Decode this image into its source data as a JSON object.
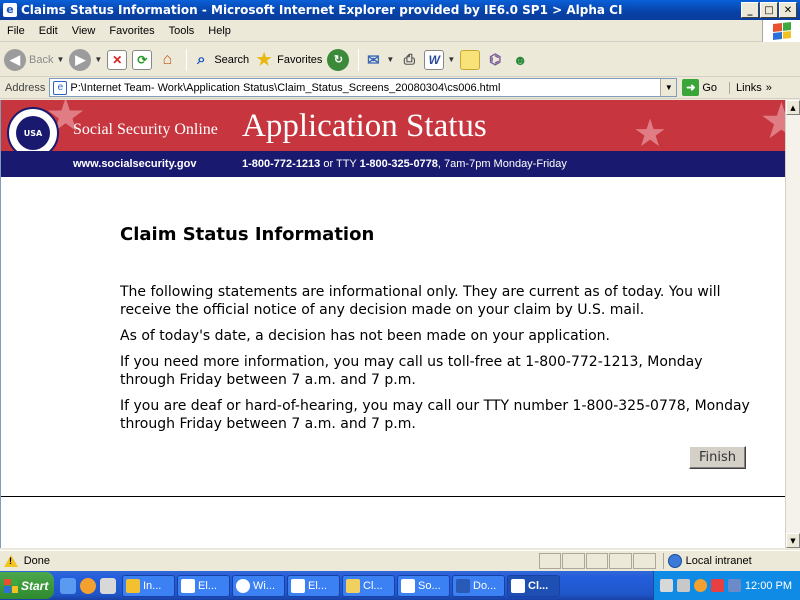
{
  "window": {
    "title": "Claims Status Information - Microsoft Internet Explorer provided by IE6.0 SP1 > Alpha CI",
    "buttons": {
      "minimize": "_",
      "maximize": "□",
      "close": "✕"
    }
  },
  "menu": [
    "File",
    "Edit",
    "View",
    "Favorites",
    "Tools",
    "Help"
  ],
  "toolbar": {
    "back": "Back",
    "search": "Search",
    "favorites": "Favorites"
  },
  "address": {
    "label": "Address",
    "url": "P:\\Internet Team- Work\\Application Status\\Claim_Status_Screens_20080304\\cs006.html",
    "go": "Go",
    "links": "Links"
  },
  "banner": {
    "seal_text": "USA",
    "brand": "Social Security Online",
    "title": "Application Status",
    "website": "www.socialsecurity.gov",
    "phone": "1-800-772-1213",
    "tty_prefix": " or TTY ",
    "tty": "1-800-325-0778",
    "hours": ", 7am-7pm Monday-Friday"
  },
  "page": {
    "heading": "Claim Status Information",
    "paragraphs": [
      "The following statements are informational only. They are current as of today. You will receive the official notice of any decision made on your claim by U.S. mail.",
      "As of today's date, a decision has not been made on your application.",
      "If you need more information, you may call us toll-free at 1-800-772-1213, Monday through Friday between 7 a.m. and 7 p.m.",
      "If you are deaf or hard-of-hearing, you may call our TTY number 1-800-325-0778, Monday through Friday between 7 a.m. and 7 p.m."
    ],
    "finish_label": "Finish"
  },
  "status": {
    "text": "Done",
    "zone": "Local intranet"
  },
  "taskbar": {
    "start": "Start",
    "tasks": [
      "In...",
      "El...",
      "Wi...",
      "El...",
      "Cl...",
      "So...",
      "Do...",
      "Cl..."
    ],
    "clock": "12:00 PM"
  }
}
